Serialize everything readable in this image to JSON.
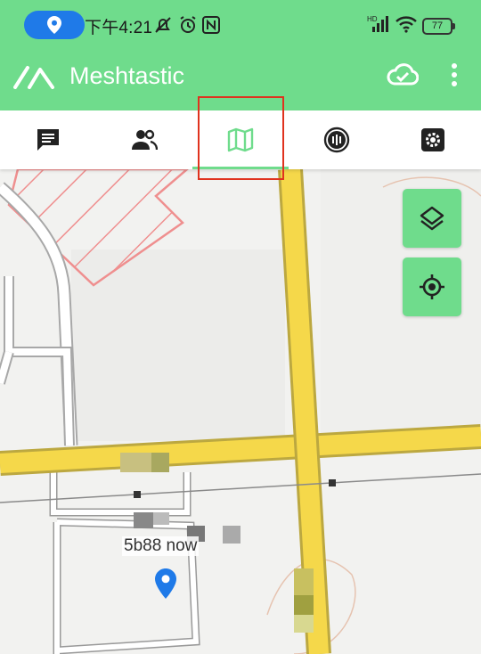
{
  "status_bar": {
    "time": "下午4:21",
    "battery": "77",
    "icons": [
      "location-icon",
      "mute-icon",
      "alarm-icon",
      "nfc-icon",
      "signal-icon",
      "wifi-icon",
      "battery-icon"
    ]
  },
  "app_bar": {
    "title": "Meshtastic",
    "icons": [
      "meshtastic-logo",
      "cloud-check-icon",
      "overflow-menu-icon"
    ]
  },
  "tabs": [
    {
      "icon": "messages-icon",
      "selected": false
    },
    {
      "icon": "nodes-icon",
      "selected": false
    },
    {
      "icon": "map-icon",
      "selected": true
    },
    {
      "icon": "channel-icon",
      "selected": false
    },
    {
      "icon": "settings-icon",
      "selected": false
    }
  ],
  "map": {
    "node_label": "5b88 now",
    "buttons": [
      "layers-icon",
      "my-location-icon"
    ]
  },
  "colors": {
    "accent": "#6fdc8c",
    "highlight": "#e0321e",
    "road": "#f5d84a",
    "pin": "#1f7ae8"
  }
}
